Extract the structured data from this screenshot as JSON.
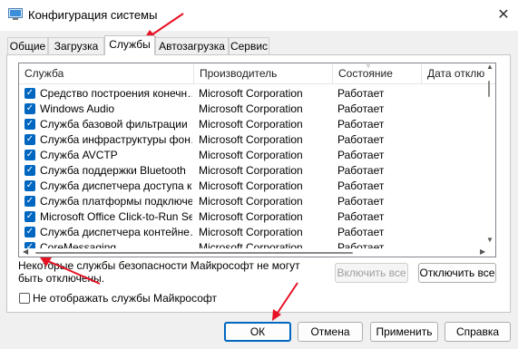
{
  "window": {
    "title": "Конфигурация системы",
    "close_glyph": "✕"
  },
  "tabs": [
    {
      "label": "Общие"
    },
    {
      "label": "Загрузка"
    },
    {
      "label": "Службы",
      "active": true
    },
    {
      "label": "Автозагрузка"
    },
    {
      "label": "Сервис"
    }
  ],
  "table": {
    "columns": [
      "Служба",
      "Производитель",
      "Состояние",
      "Дата отклю"
    ],
    "check_glyph": "✓",
    "rows": [
      {
        "name": "Средство построения конечн…",
        "maker": "Microsoft Corporation",
        "status": "Работает"
      },
      {
        "name": "Windows Audio",
        "maker": "Microsoft Corporation",
        "status": "Работает"
      },
      {
        "name": "Служба базовой фильтрации",
        "maker": "Microsoft Corporation",
        "status": "Работает"
      },
      {
        "name": "Служба инфраструктуры фон…",
        "maker": "Microsoft Corporation",
        "status": "Работает"
      },
      {
        "name": "Служба AVCTP",
        "maker": "Microsoft Corporation",
        "status": "Работает"
      },
      {
        "name": "Служба поддержки Bluetooth",
        "maker": "Microsoft Corporation",
        "status": "Работает"
      },
      {
        "name": "Служба диспетчера доступа к…",
        "maker": "Microsoft Corporation",
        "status": "Работает"
      },
      {
        "name": "Служба платформы подключе…",
        "maker": "Microsoft Corporation",
        "status": "Работает"
      },
      {
        "name": "Microsoft Office Click-to-Run Ser…",
        "maker": "Microsoft Corporation",
        "status": "Работает"
      },
      {
        "name": "Служба диспетчера контейне…",
        "maker": "Microsoft Corporation",
        "status": "Работает"
      },
      {
        "name": "CoreMessaging",
        "maker": "Microsoft Corporation",
        "status": "Работает"
      }
    ]
  },
  "note": "Некоторые службы безопасности Майкрософт не могут быть отключены.",
  "buttons": {
    "enable_all": "Включить все",
    "disable_all": "Отключить все",
    "ok": "ОК",
    "cancel": "Отмена",
    "apply": "Применить",
    "help": "Справка"
  },
  "hide_ms_services": {
    "label": "Не отображать службы Майкрософт",
    "checked": false
  },
  "colors": {
    "accent": "#0067c0",
    "arrow": "#e81123"
  }
}
